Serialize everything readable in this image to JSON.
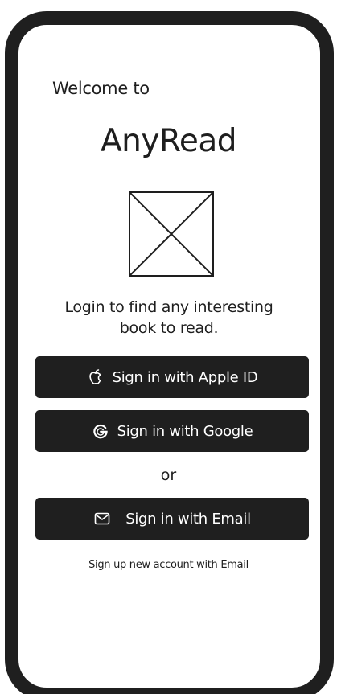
{
  "welcome": {
    "greeting": "Welcome to",
    "app_name": "AnyRead",
    "tagline": "Login to find any interesting book to read."
  },
  "buttons": {
    "apple": {
      "label": "Sign in with Apple ID",
      "icon": "apple-icon"
    },
    "google": {
      "label": "Sign in with Google",
      "icon": "google-icon"
    },
    "email": {
      "label": "Sign in with Email",
      "icon": "mail-icon"
    }
  },
  "divider": {
    "text": "or"
  },
  "signup": {
    "link_text": "Sign up new account with Email"
  },
  "colors": {
    "frame": "#1f1f1f",
    "button_bg": "#1f1f1f",
    "button_text": "#ffffff",
    "text": "#1e1e1e",
    "background": "#ffffff"
  }
}
